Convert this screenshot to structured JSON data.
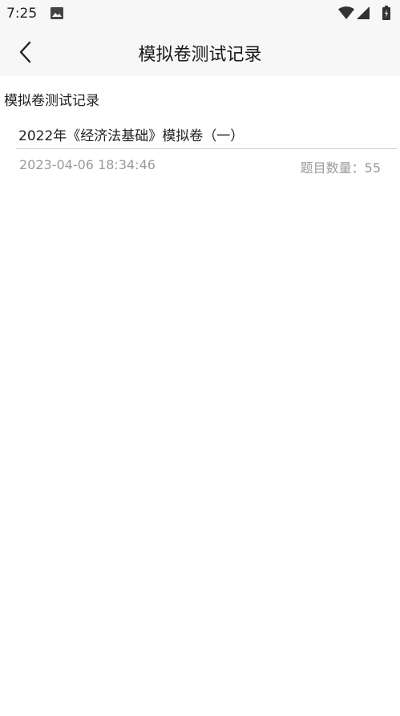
{
  "status_bar": {
    "time": "7:25",
    "icons": [
      "image-icon",
      "wifi-icon",
      "signal-icon",
      "battery-icon"
    ]
  },
  "header": {
    "title": "模拟卷测试记录",
    "back_icon": "chevron-left-icon"
  },
  "section": {
    "title": "模拟卷测试记录"
  },
  "records": [
    {
      "name": "2022年《经济法基础》模拟卷（一）",
      "time": "2023-04-06 18:34:46",
      "count_label": "题目数量：",
      "count": "55"
    }
  ],
  "colors": {
    "bar_background": "#f7f7f7",
    "secondary_text": "#9a9a9a",
    "divider": "#cfcfcf"
  }
}
